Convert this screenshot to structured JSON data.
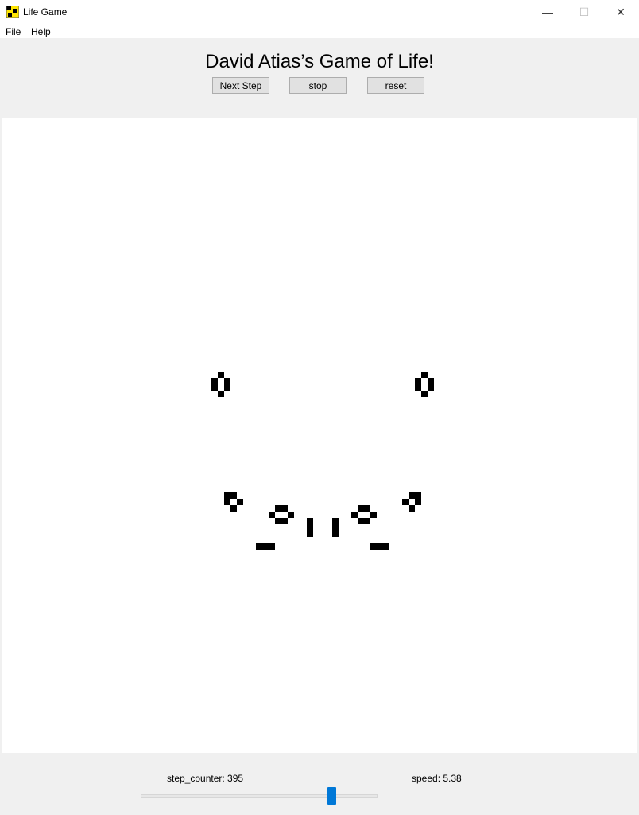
{
  "window": {
    "title": "Life Game",
    "minimize_glyph": "—",
    "maximize_glyph": "☐",
    "close_glyph": "✕",
    "accent": "#0078d7"
  },
  "menu": {
    "items": [
      "File",
      "Help"
    ]
  },
  "header": {
    "title": "David Atias’s Game of Life!"
  },
  "toolbar": {
    "next_label": "Next Step",
    "stop_label": "stop",
    "reset_label": "reset"
  },
  "status": {
    "step_counter_text": "step_counter: 395",
    "step_counter": 395,
    "speed_text": "speed: 5.38",
    "speed": 5.38,
    "speed_slider_fraction": 0.82
  },
  "grid": {
    "rows": 100,
    "cols": 100,
    "live_cells": [
      [
        40,
        34
      ],
      [
        41,
        33
      ],
      [
        41,
        35
      ],
      [
        42,
        33
      ],
      [
        42,
        35
      ],
      [
        43,
        34
      ],
      [
        40,
        66
      ],
      [
        41,
        65
      ],
      [
        41,
        67
      ],
      [
        42,
        65
      ],
      [
        42,
        67
      ],
      [
        43,
        66
      ],
      [
        59,
        35
      ],
      [
        59,
        36
      ],
      [
        60,
        35
      ],
      [
        60,
        37
      ],
      [
        61,
        36
      ],
      [
        59,
        64
      ],
      [
        59,
        65
      ],
      [
        60,
        63
      ],
      [
        60,
        65
      ],
      [
        61,
        64
      ],
      [
        61,
        43
      ],
      [
        61,
        44
      ],
      [
        62,
        42
      ],
      [
        62,
        45
      ],
      [
        63,
        43
      ],
      [
        63,
        44
      ],
      [
        61,
        56
      ],
      [
        61,
        57
      ],
      [
        62,
        55
      ],
      [
        62,
        58
      ],
      [
        63,
        56
      ],
      [
        63,
        57
      ],
      [
        63,
        48
      ],
      [
        64,
        48
      ],
      [
        65,
        48
      ],
      [
        63,
        52
      ],
      [
        64,
        52
      ],
      [
        65,
        52
      ],
      [
        67,
        40
      ],
      [
        67,
        41
      ],
      [
        67,
        42
      ],
      [
        67,
        58
      ],
      [
        67,
        59
      ],
      [
        67,
        60
      ]
    ]
  }
}
